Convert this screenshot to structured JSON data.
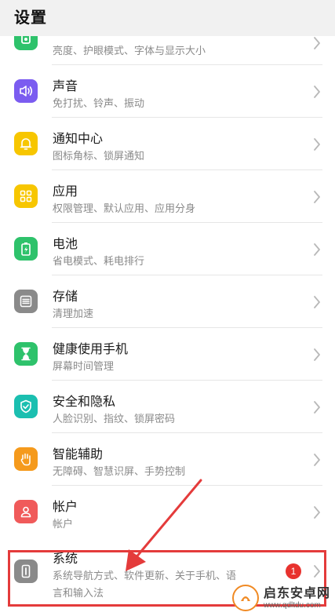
{
  "header": {
    "title": "设置"
  },
  "items": [
    {
      "id": "display",
      "title": "",
      "subtitle": "亮度、护眼模式、字体与显示大小",
      "icon": "display-icon",
      "color": "#2ec26b"
    },
    {
      "id": "sound",
      "title": "声音",
      "subtitle": "免打扰、铃声、振动",
      "icon": "speaker-icon",
      "color": "#7b5cf0"
    },
    {
      "id": "notifications",
      "title": "通知中心",
      "subtitle": "图标角标、锁屏通知",
      "icon": "bell-icon",
      "color": "#f7c600"
    },
    {
      "id": "apps",
      "title": "应用",
      "subtitle": "权限管理、默认应用、应用分身",
      "icon": "apps-grid-icon",
      "color": "#f7c600"
    },
    {
      "id": "battery",
      "title": "电池",
      "subtitle": "省电模式、耗电排行",
      "icon": "battery-icon",
      "color": "#2ec26b"
    },
    {
      "id": "storage",
      "title": "存储",
      "subtitle": "清理加速",
      "icon": "storage-icon",
      "color": "#8a8a8a"
    },
    {
      "id": "digital-wellbeing",
      "title": "健康使用手机",
      "subtitle": "屏幕时间管理",
      "icon": "hourglass-icon",
      "color": "#2ec26b"
    },
    {
      "id": "security",
      "title": "安全和隐私",
      "subtitle": "人脸识别、指纹、锁屏密码",
      "icon": "shield-icon",
      "color": "#1bbfb0"
    },
    {
      "id": "accessibility",
      "title": "智能辅助",
      "subtitle": "无障碍、智慧识屏、手势控制",
      "icon": "hand-icon",
      "color": "#f59a1c"
    },
    {
      "id": "account",
      "title": "帐户",
      "subtitle": "帐户",
      "icon": "user-icon",
      "color": "#f05a5a"
    },
    {
      "id": "system",
      "title": "系统",
      "subtitle": "系统导航方式、软件更新、关于手机、语",
      "subtitle2": "言和输入法",
      "icon": "phone-icon",
      "color": "#8a8a8a",
      "badge": "1"
    }
  ],
  "watermark": {
    "name": "启东安卓网",
    "url": "www.qdltdu.com"
  }
}
